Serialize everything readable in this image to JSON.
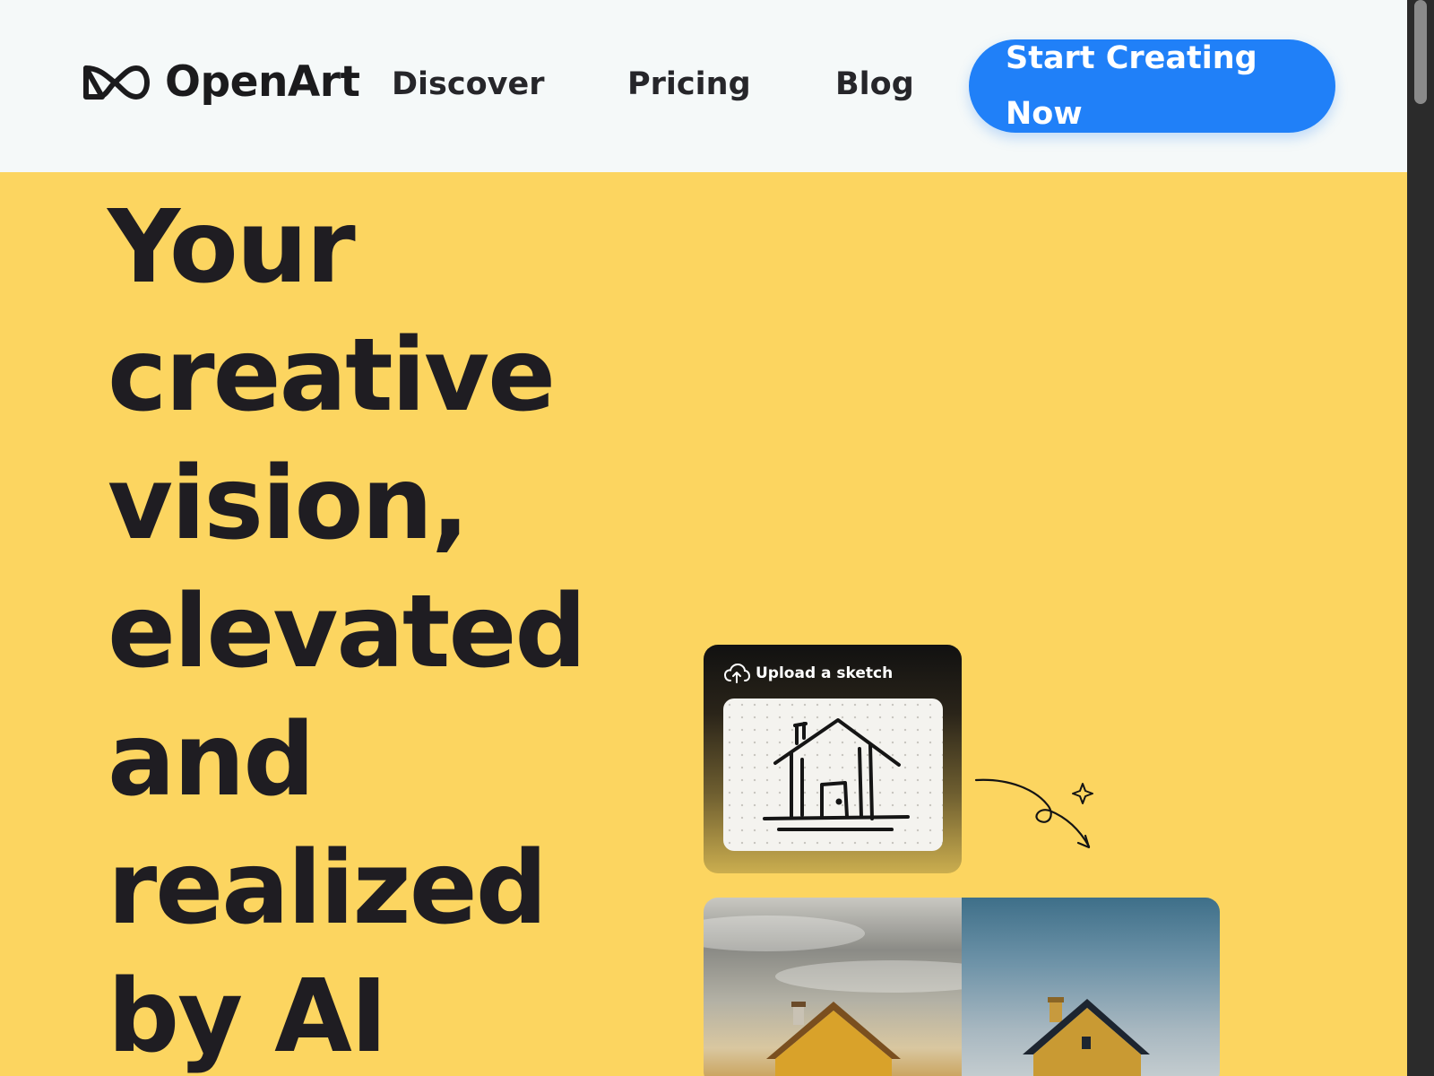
{
  "header": {
    "brand": "OpenArt",
    "nav": {
      "discover": "Discover",
      "pricing": "Pricing",
      "blog": "Blog"
    },
    "cta_label": "Start Creating Now"
  },
  "hero": {
    "headline": "Your creative vision, elevated and realized by AI"
  },
  "sketch_card": {
    "label": "Upload a sketch"
  },
  "icons": {
    "logo": "infinity-logo-icon",
    "upload": "cloud-upload-icon",
    "sparkle": "sparkle-icon"
  },
  "colors": {
    "hero_background": "#fcd560",
    "header_background": "#f5f9f9",
    "cta_background": "#2080f8",
    "headline_text": "#1f1d22"
  }
}
